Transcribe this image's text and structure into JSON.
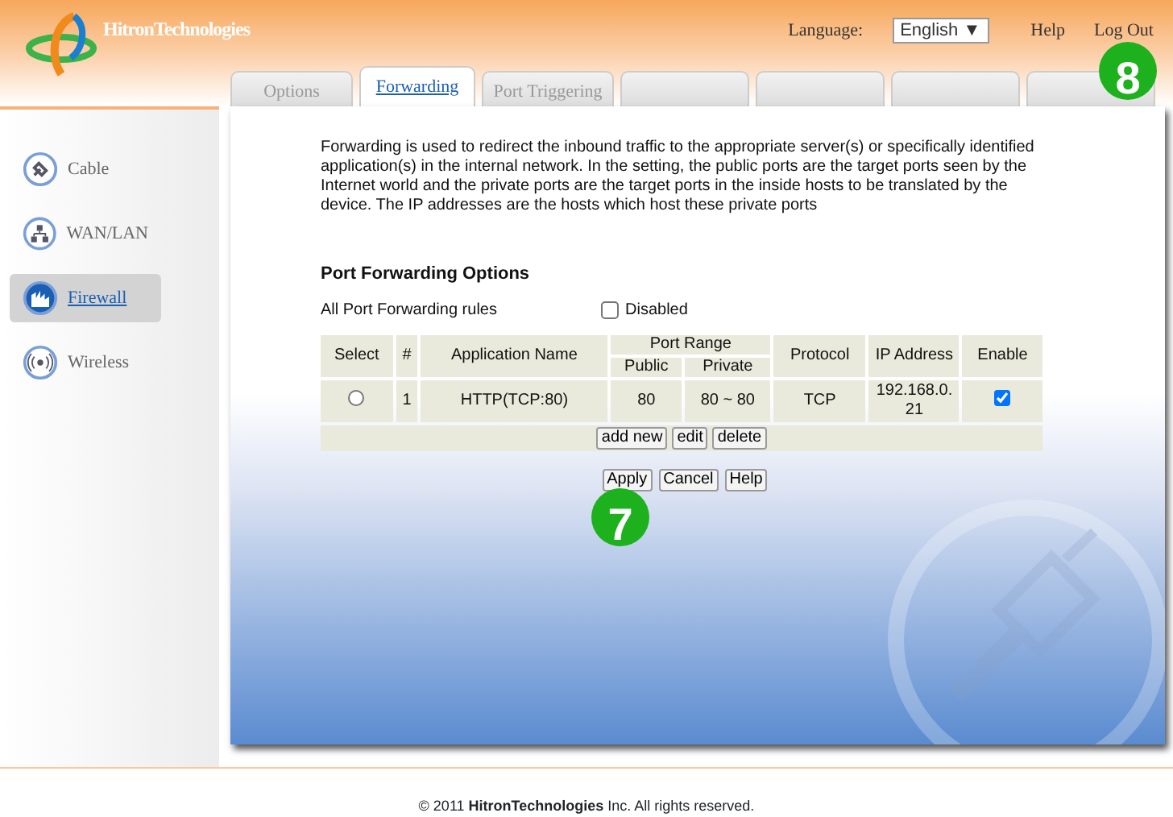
{
  "header": {
    "logo": "HitronTechnologies",
    "language_label": "Language:",
    "language": "English ▼",
    "links": [
      "Help",
      "Log Out"
    ]
  },
  "tabs": [
    {
      "label": "Options",
      "selected": false
    },
    {
      "label": "Forwarding",
      "selected": true
    },
    {
      "label": "Port Triggering",
      "selected": false
    }
  ],
  "sidebar": {
    "items": [
      {
        "label": "Cable",
        "kind": "cable",
        "selected": false
      },
      {
        "label": "WAN/LAN",
        "kind": "network",
        "selected": false
      },
      {
        "label": "Firewall",
        "kind": "firewall",
        "selected": true
      },
      {
        "label": "Wireless",
        "kind": "wireless",
        "selected": false
      }
    ]
  },
  "description": "Forwarding is used to redirect the inbound traffic to the appropriate server(s) or specifically identified application(s) in the internal network. In the setting, the public ports are the target ports seen by the Internet world and the private ports are the target ports in the inside hosts to be translated by the device. The IP addresses are the hosts which host these private ports",
  "section_title": "Port Forwarding Options",
  "all_rules": {
    "label": "All Port Forwarding rules",
    "option": "Disabled",
    "checked": false
  },
  "table": {
    "columns": [
      "Select",
      "#",
      "Application Name",
      "Port Range",
      "Protocol",
      "IP Address",
      "Enable"
    ],
    "subcolumns": [
      "Public",
      "Private"
    ],
    "rows": [
      {
        "selected": false,
        "number": "1",
        "application": "HTTP(TCP:80)",
        "public": "80",
        "private": "80 ~ 80",
        "protocol": "TCP",
        "ip": "192.168.0.21",
        "enabled": true
      }
    ],
    "actions": [
      "add new",
      "edit",
      "delete"
    ]
  },
  "buttons": [
    "Apply",
    "Cancel",
    "Help"
  ],
  "step_markers": [
    "8",
    "7"
  ],
  "footer": "© 2011 **HitronTechnologies** Inc.  All rights reserved."
}
